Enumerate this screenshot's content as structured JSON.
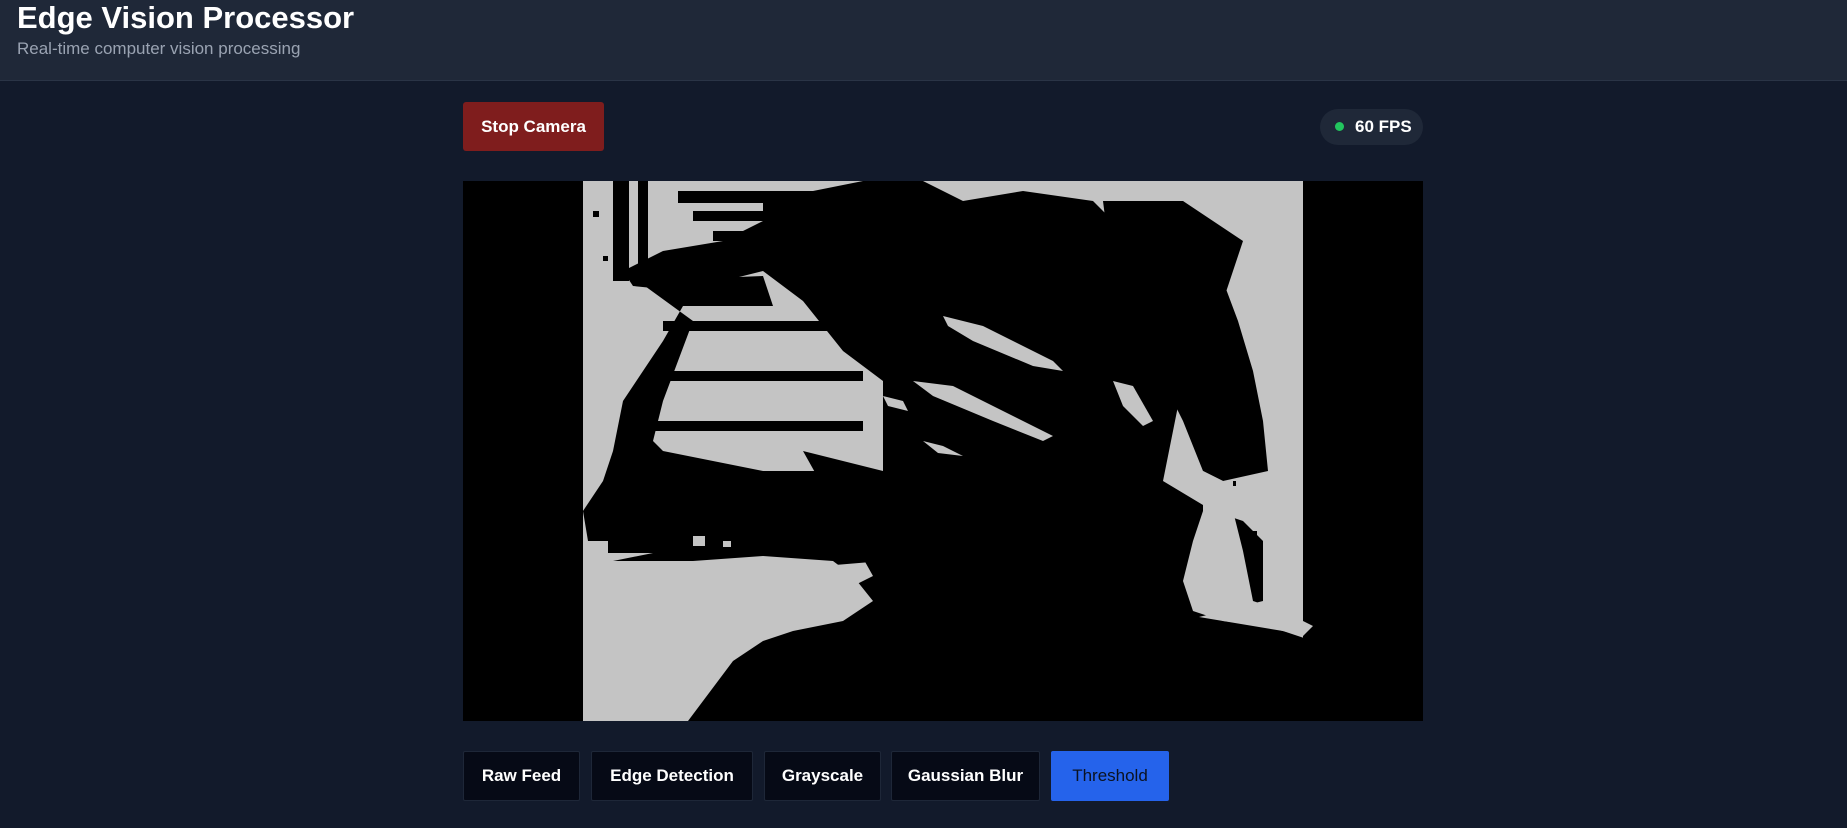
{
  "header": {
    "title": "Edge Vision Processor",
    "subtitle": "Real-time computer vision processing"
  },
  "controls": {
    "stop_label": "Stop Camera",
    "fps_label": "60 FPS",
    "status_color": "#22c55e"
  },
  "video": {
    "active_filter": "Threshold"
  },
  "modes": [
    {
      "label": "Raw Feed",
      "active": false
    },
    {
      "label": "Edge Detection",
      "active": false
    },
    {
      "label": "Grayscale",
      "active": false
    },
    {
      "label": "Gaussian Blur",
      "active": false
    },
    {
      "label": "Threshold",
      "active": true
    }
  ],
  "colors": {
    "background": "#121a2b",
    "header": "#1f2838",
    "stop_button": "#7f1d1d",
    "active_mode": "#2563eb",
    "threshold_light": "#c4c4c4"
  }
}
